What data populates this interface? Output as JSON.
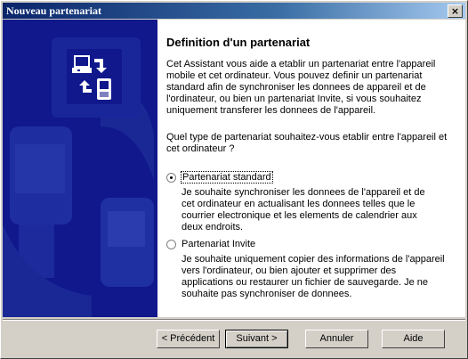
{
  "window": {
    "title": "Nouveau partenariat",
    "close_glyph": "×"
  },
  "page": {
    "heading": "Definition d'un partenariat",
    "intro_lines": [
      "Cet Assistant vous aide a etablir un partenariat entre l'appareil",
      "mobile et cet ordinateur. Vous pouvez definir un partenariat",
      "standard afin de synchroniser les donnees de appareil et de",
      "l'ordinateur, ou bien un partenariat Invite, si vous souhaitez",
      "uniquement transferer les donnees de l'appareil."
    ],
    "question_lines": [
      "Quel type de partenariat souhaitez-vous etablir entre l'appareil et",
      "cet ordinateur ?"
    ],
    "options": [
      {
        "label": "Partenariat standard",
        "checked": true,
        "desc_lines": [
          "Je souhaite synchroniser les donnees de l'appareil et de",
          "cet ordinateur en actualisant les donnees telles que le",
          "courrier electronique et les elements de calendrier aux",
          "deux endroits."
        ]
      },
      {
        "label": "Partenariat Invite",
        "checked": false,
        "desc_lines": [
          "Je souhaite uniquement copier des informations de l'appareil",
          "vers l'ordinateur, ou bien ajouter et supprimer des",
          "applications ou restaurer un fichier de sauvegarde. Je ne",
          "souhaite pas synchroniser de donnees."
        ]
      }
    ]
  },
  "buttons": {
    "back": "< Précédent",
    "next": "Suivant >",
    "cancel": "Annuler",
    "help": "Aide"
  },
  "icons": {
    "wizard": "sync-devices-icon"
  },
  "colors": {
    "sidebar": "#10188c",
    "titlebar": "#0a246a"
  }
}
